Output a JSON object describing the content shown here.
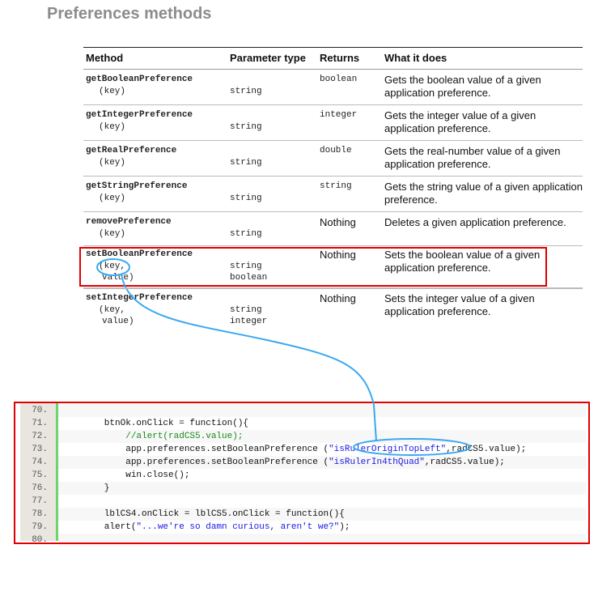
{
  "title": "Preferences methods",
  "table": {
    "headers": [
      "Method",
      "Parameter type",
      "Returns",
      "What it does"
    ],
    "rows": [
      {
        "method": "getBooleanPreference",
        "args": [
          "(key)"
        ],
        "types": [
          "string"
        ],
        "returns": "boolean",
        "desc": "Gets the boolean value of a given application preference."
      },
      {
        "method": "getIntegerPreference",
        "args": [
          "(key)"
        ],
        "types": [
          "string"
        ],
        "returns": "integer",
        "desc": "Gets the integer value of a given application preference."
      },
      {
        "method": "getRealPreference",
        "args": [
          "(key)"
        ],
        "types": [
          "string"
        ],
        "returns": "double",
        "desc": "Gets the real-number value of a given application preference."
      },
      {
        "method": "getStringPreference",
        "args": [
          "(key)"
        ],
        "types": [
          "string"
        ],
        "returns": "string",
        "desc": "Gets the string value of a given application preference."
      },
      {
        "method": "removePreference",
        "args": [
          "(key)"
        ],
        "types": [
          "string"
        ],
        "returns": "Nothing",
        "desc": "Deletes a given application preference."
      },
      {
        "method": "setBooleanPreference",
        "args": [
          "(key,",
          " value)"
        ],
        "types": [
          "string",
          "boolean"
        ],
        "returns": "Nothing",
        "desc": "Sets the boolean value of a given application preference."
      },
      {
        "method": "setIntegerPreference",
        "args": [
          "(key,",
          " value)"
        ],
        "types": [
          "string",
          "integer"
        ],
        "returns": "Nothing",
        "desc": "Sets the integer value of a given application preference."
      }
    ]
  },
  "code": {
    "lines": [
      {
        "n": "70.",
        "parts": []
      },
      {
        "n": "71.",
        "parts": [
          {
            "t": "        btnOk.onClick = function(){",
            "c": ""
          }
        ]
      },
      {
        "n": "72.",
        "parts": [
          {
            "t": "            //alert(radCS5.value);",
            "c": "cm"
          }
        ]
      },
      {
        "n": "73.",
        "parts": [
          {
            "t": "            app.preferences.setBooleanPreference (",
            "c": ""
          },
          {
            "t": "\"isRulerOriginTopLeft\"",
            "c": "st"
          },
          {
            "t": ",radCS5.value);",
            "c": ""
          }
        ]
      },
      {
        "n": "74.",
        "parts": [
          {
            "t": "            app.preferences.setBooleanPreference (",
            "c": ""
          },
          {
            "t": "\"isRulerIn4thQuad\"",
            "c": "st"
          },
          {
            "t": ",radCS5.value);",
            "c": ""
          }
        ]
      },
      {
        "n": "75.",
        "parts": [
          {
            "t": "            win.close();",
            "c": ""
          }
        ]
      },
      {
        "n": "76.",
        "parts": [
          {
            "t": "        }",
            "c": ""
          }
        ]
      },
      {
        "n": "77.",
        "parts": []
      },
      {
        "n": "78.",
        "parts": [
          {
            "t": "        lblCS4.onClick = lblCS5.onClick = function(){",
            "c": ""
          }
        ]
      },
      {
        "n": "79.",
        "parts": [
          {
            "t": "        alert(",
            "c": ""
          },
          {
            "t": "\"...we're so damn curious, aren't we?\"",
            "c": "st"
          },
          {
            "t": ");",
            "c": ""
          }
        ]
      },
      {
        "n": "80.",
        "parts": []
      }
    ]
  },
  "colors": {
    "highlight": "#e00000",
    "annotation": "#3aa8f0"
  }
}
